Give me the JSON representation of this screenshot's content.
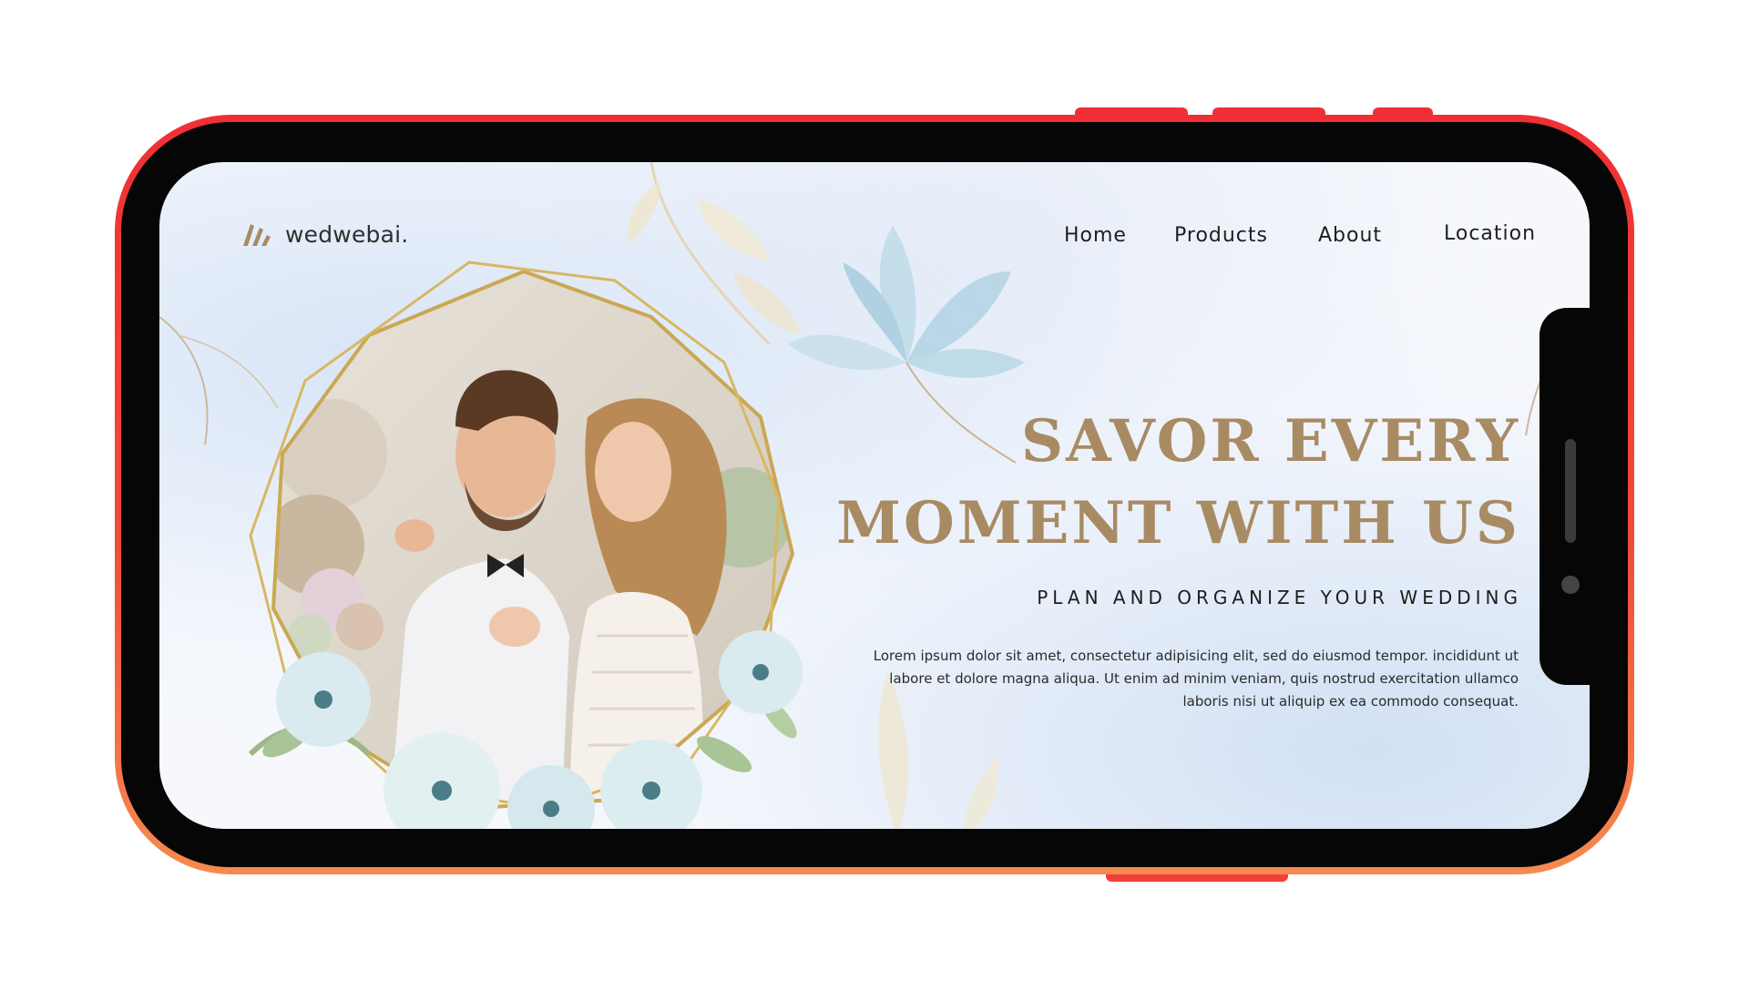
{
  "brand": {
    "name": "wedwebai.",
    "logo_color": "#a88b63"
  },
  "nav": {
    "items": [
      "Home",
      "Products",
      "About",
      "Location"
    ]
  },
  "hero": {
    "title": "SAVOR EVERY\nMOMENT WITH US",
    "subtitle": "PLAN AND ORGANIZE YOUR WEDDING",
    "body": "Lorem ipsum dolor sit amet, consectetur adipisicing elit, sed do eiusmod tempor. incididunt ut labore et dolore magna aliqua. Ut enim ad minim veniam, quis nostrud exercitation ullamco laboris nisi ut aliquip ex ea commodo consequat."
  },
  "colors": {
    "accent_gold": "#a88b63",
    "phone_frame": "#ef2f35",
    "text_dark": "#1e1e1e"
  },
  "icons": {
    "logo": "wedwebai-logo-icon",
    "camera": "front-camera-icon",
    "speaker": "earpiece-speaker-icon"
  }
}
